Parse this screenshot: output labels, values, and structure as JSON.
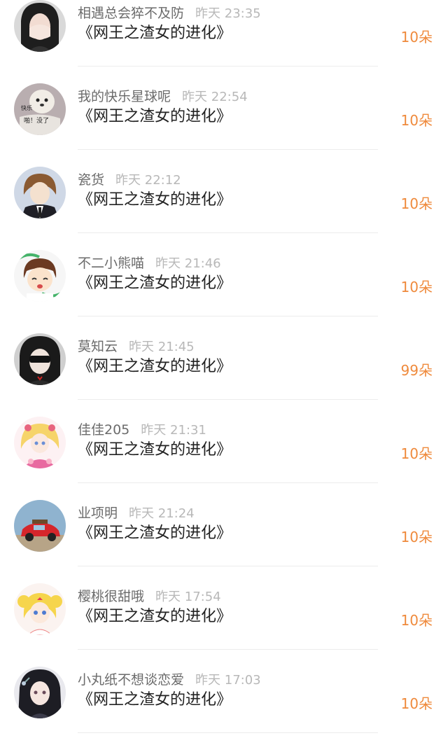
{
  "colors": {
    "accent": "#ef8a3c",
    "username": "#6b6b6b",
    "timestamp": "#b8b8b8",
    "title": "#222222"
  },
  "items": [
    {
      "username": "相遇总会猝不及防",
      "time": "昨天 23:35",
      "title": "《网王之渣女的进化》",
      "count": "10朵",
      "avatar": "avatar-girl-covering-face"
    },
    {
      "username": "我的快乐星球呢",
      "time": "昨天 22:54",
      "title": "《网王之渣女的进化》",
      "count": "10朵",
      "avatar": "avatar-dog-meme",
      "avatar_text": [
        "快乐",
        "啪！没了"
      ]
    },
    {
      "username": "瓷货",
      "time": "昨天 22:12",
      "title": "《网王之渣女的进化》",
      "count": "10朵",
      "avatar": "avatar-anime-boy-suit"
    },
    {
      "username": "不二小熊喵",
      "time": "昨天 21:46",
      "title": "《网王之渣女的进化》",
      "count": "10朵",
      "avatar": "avatar-chibi-boy"
    },
    {
      "username": "莫知云",
      "time": "昨天 21:45",
      "title": "《网王之渣女的进化》",
      "count": "99朵",
      "avatar": "avatar-girl-eye-mask"
    },
    {
      "username": "佳佳205",
      "time": "昨天 21:31",
      "title": "《网王之渣女的进化》",
      "count": "10朵",
      "avatar": "avatar-anime-princess"
    },
    {
      "username": "业项明",
      "time": "昨天 21:24",
      "title": "《网王之渣女的进化》",
      "count": "10朵",
      "avatar": "avatar-red-car"
    },
    {
      "username": "樱桃很甜哦",
      "time": "昨天 17:54",
      "title": "《网王之渣女的进化》",
      "count": "10朵",
      "avatar": "avatar-sailor-moon"
    },
    {
      "username": "小丸纸不想谈恋爱",
      "time": "昨天 17:03",
      "title": "《网王之渣女的进化》",
      "count": "10朵",
      "avatar": "avatar-anime-girl-dark-hair"
    }
  ]
}
